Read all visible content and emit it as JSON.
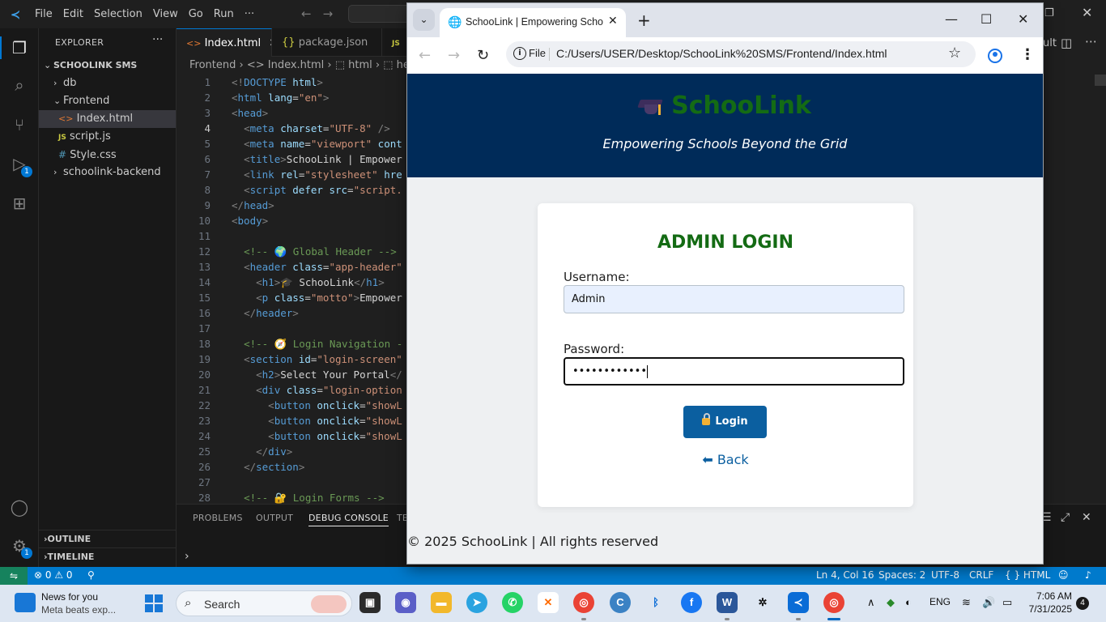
{
  "vscode": {
    "menu": [
      "File",
      "Edit",
      "Selection",
      "View",
      "Go",
      "Run",
      "···"
    ],
    "layout_text": "ult",
    "activity_badges": {
      "debug": "1",
      "accounts": "1"
    },
    "explorer": {
      "title": "EXPLORER",
      "project": "SCHOOLINK SMS",
      "items": [
        {
          "label": "db",
          "type": "folder-collapsed"
        },
        {
          "label": "Frontend",
          "type": "folder-open"
        },
        {
          "label": "Index.html",
          "type": "html",
          "icon": "<>"
        },
        {
          "label": "script.js",
          "type": "js",
          "icon": "JS"
        },
        {
          "label": "Style.css",
          "type": "css",
          "icon": "#"
        },
        {
          "label": "schoolink-backend",
          "type": "folder-collapsed"
        }
      ],
      "outline": "OUTLINE",
      "timeline": "TIMELINE"
    },
    "tabs": [
      {
        "label": "Index.html",
        "icon": "<>"
      },
      {
        "label": "package.json",
        "icon": "{}"
      },
      {
        "label": "JS",
        "icon": ""
      }
    ],
    "breadcrumbs": "Frontend  ›  <> Index.html  ›  ⬚ html  ›  ⬚ hea",
    "code_lines": [
      {
        "n": "1",
        "html": "<span class='t-br'>&lt;!</span><span class='t-tag'>DOCTYPE</span> <span class='t-attr'>html</span><span class='t-br'>&gt;</span>"
      },
      {
        "n": "2",
        "html": "<span class='t-br'>&lt;</span><span class='t-tag'>html</span> <span class='t-attr'>lang</span>=<span class='t-str'>\"en\"</span><span class='t-br'>&gt;</span>"
      },
      {
        "n": "3",
        "html": "<span class='t-br'>&lt;</span><span class='t-tag'>head</span><span class='t-br'>&gt;</span>"
      },
      {
        "n": "4",
        "html": "  <span class='t-br'>&lt;</span><span class='t-tag'>meta</span> <span class='t-attr'>charset</span>=<span class='t-str'>\"UTF-8\"</span> <span class='t-br'>/&gt;</span>"
      },
      {
        "n": "5",
        "html": "  <span class='t-br'>&lt;</span><span class='t-tag'>meta</span> <span class='t-attr'>name</span>=<span class='t-str'>\"viewport\"</span> <span class='t-attr'>cont</span>"
      },
      {
        "n": "6",
        "html": "  <span class='t-br'>&lt;</span><span class='t-tag'>title</span><span class='t-br'>&gt;</span><span class='t-txt'>SchooLink | Empower</span>"
      },
      {
        "n": "7",
        "html": "  <span class='t-br'>&lt;</span><span class='t-tag'>link</span> <span class='t-attr'>rel</span>=<span class='t-str'>\"stylesheet\"</span> <span class='t-attr'>hre</span>"
      },
      {
        "n": "8",
        "html": "  <span class='t-br'>&lt;</span><span class='t-tag'>script</span> <span class='t-attr'>defer</span> <span class='t-attr'>src</span>=<span class='t-str'>\"script.</span>"
      },
      {
        "n": "9",
        "html": "<span class='t-br'>&lt;/</span><span class='t-tag'>head</span><span class='t-br'>&gt;</span>"
      },
      {
        "n": "10",
        "html": "<span class='t-br'>&lt;</span><span class='t-tag'>body</span><span class='t-br'>&gt;</span>"
      },
      {
        "n": "11",
        "html": ""
      },
      {
        "n": "12",
        "html": "  <span class='t-com'>&lt;!-- 🌍 Global Header --&gt;</span>"
      },
      {
        "n": "13",
        "html": "  <span class='t-br'>&lt;</span><span class='t-tag'>header</span> <span class='t-attr'>class</span>=<span class='t-str'>\"app-header\"</span>"
      },
      {
        "n": "14",
        "html": "    <span class='t-br'>&lt;</span><span class='t-tag'>h1</span><span class='t-br'>&gt;</span><span class='t-txt'>🎓 SchooLink</span><span class='t-br'>&lt;/</span><span class='t-tag'>h1</span><span class='t-br'>&gt;</span>"
      },
      {
        "n": "15",
        "html": "    <span class='t-br'>&lt;</span><span class='t-tag'>p</span> <span class='t-attr'>class</span>=<span class='t-str'>\"motto\"</span><span class='t-br'>&gt;</span><span class='t-txt'>Empower</span>"
      },
      {
        "n": "16",
        "html": "  <span class='t-br'>&lt;/</span><span class='t-tag'>header</span><span class='t-br'>&gt;</span>"
      },
      {
        "n": "17",
        "html": ""
      },
      {
        "n": "18",
        "html": "  <span class='t-com'>&lt;!-- 🧭 Login Navigation -</span>"
      },
      {
        "n": "19",
        "html": "  <span class='t-br'>&lt;</span><span class='t-tag'>section</span> <span class='t-attr'>id</span>=<span class='t-str'>\"login-screen\"</span>"
      },
      {
        "n": "20",
        "html": "    <span class='t-br'>&lt;</span><span class='t-tag'>h2</span><span class='t-br'>&gt;</span><span class='t-txt'>Select Your Portal</span><span class='t-br'>&lt;/</span>"
      },
      {
        "n": "21",
        "html": "    <span class='t-br'>&lt;</span><span class='t-tag'>div</span> <span class='t-attr'>class</span>=<span class='t-str'>\"login-option</span>"
      },
      {
        "n": "22",
        "html": "      <span class='t-br'>&lt;</span><span class='t-tag'>button</span> <span class='t-attr'>onclick</span>=<span class='t-str'>\"showL</span>"
      },
      {
        "n": "23",
        "html": "      <span class='t-br'>&lt;</span><span class='t-tag'>button</span> <span class='t-attr'>onclick</span>=<span class='t-str'>\"showL</span>"
      },
      {
        "n": "24",
        "html": "      <span class='t-br'>&lt;</span><span class='t-tag'>button</span> <span class='t-attr'>onclick</span>=<span class='t-str'>\"showL</span>"
      },
      {
        "n": "25",
        "html": "    <span class='t-br'>&lt;/</span><span class='t-tag'>div</span><span class='t-br'>&gt;</span>"
      },
      {
        "n": "26",
        "html": "  <span class='t-br'>&lt;/</span><span class='t-tag'>section</span><span class='t-br'>&gt;</span>"
      },
      {
        "n": "27",
        "html": ""
      },
      {
        "n": "28",
        "html": "  <span class='t-com'>&lt;!-- 🔐 Login Forms --&gt;</span>"
      }
    ],
    "current_line": "4",
    "panel_tabs": [
      "PROBLEMS",
      "OUTPUT",
      "DEBUG CONSOLE",
      "TE"
    ],
    "status": {
      "problems": "⊗ 0 ⚠ 0",
      "position": "Ln 4, Col 16",
      "spaces": "Spaces: 2",
      "encoding": "UTF-8",
      "eol": "CRLF",
      "language": "{ } HTML"
    }
  },
  "chrome": {
    "tab_title": "SchooLink | Empowering Schools Beyond the Grid",
    "file_label": "File",
    "url": "C:/Users/USER/Desktop/SchooLink%20SMS/Frontend/Index.html"
  },
  "page": {
    "logo": "SchooLink",
    "motto": "Empowering Schools Beyond the Grid",
    "login_title": "ADMIN LOGIN",
    "username_label": "Username:",
    "username_value": "Admin",
    "password_label": "Password:",
    "password_mask": "••••••••••••",
    "login_button": "Login",
    "back_link": "⬅ Back",
    "footer": "© 2025 SchooLink | All rights reserved",
    "colors": {
      "header_bg": "#002b59",
      "brand_green": "#146b14",
      "button_blue": "#0b5fa0"
    }
  },
  "taskbar": {
    "news_title": "News for you",
    "news_sub": "Meta beats exp...",
    "search": "Search",
    "language": "ENG",
    "time": "7:06 AM",
    "date": "7/31/2025",
    "notifications": "4"
  }
}
